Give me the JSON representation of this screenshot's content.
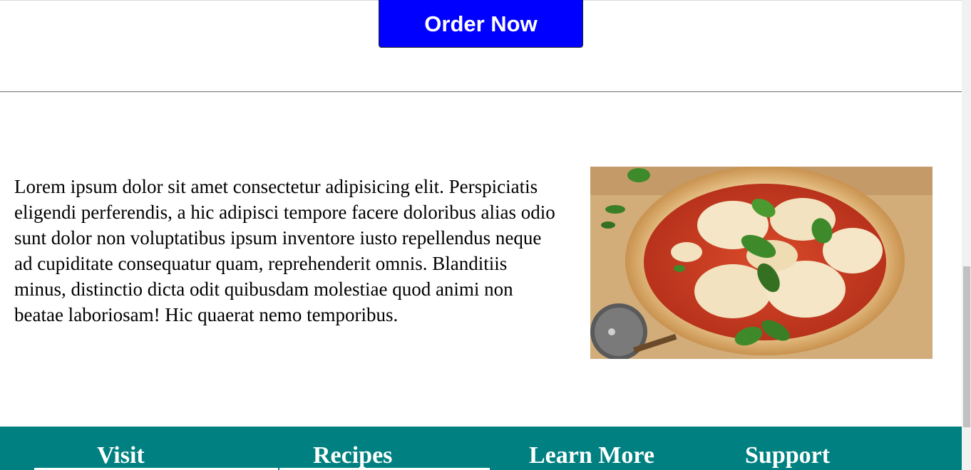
{
  "hero": {
    "order_button_label": "Order Now",
    "button_color": "#0000ff"
  },
  "about": {
    "text": "Lorem ipsum dolor sit amet consectetur adipisicing elit. Perspiciatis eligendi perferendis, a hic adipisci tempore facere doloribus alias odio sunt dolor non voluptatibus ipsum inventore iusto repellendus neque ad cupiditate consequatur quam, reprehenderit omnis. Blanditiis minus, distinctio dicta odit quibusdam molestiae quod animi non beatae laboriosam! Hic quaerat nemo temporibus.",
    "image": "margherita-pizza-photo"
  },
  "footer": {
    "background_color": "#008080",
    "headings": [
      "Visit",
      "Recipes",
      "Learn More",
      "Support"
    ]
  }
}
